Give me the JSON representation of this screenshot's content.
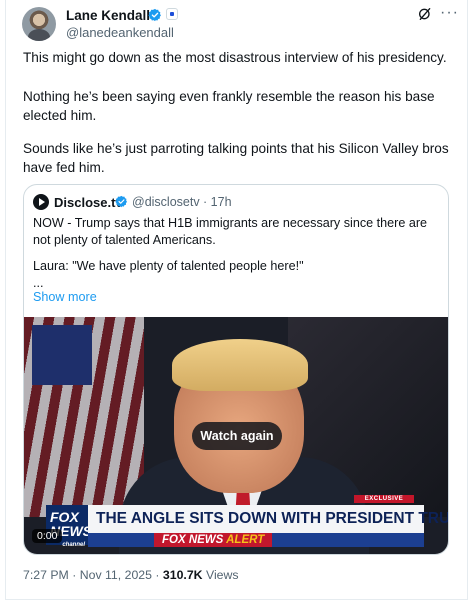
{
  "author": {
    "name": "Lane Kendall",
    "handle": "@lanedeankendall"
  },
  "tweet": {
    "paragraphs": [
      "This might go down as the most disastrous interview of his presidency.",
      "Nothing he’s been saying even frankly resemble the reason his base elected him.",
      "Sounds like he’s just parroting talking points that his Silicon Valley bros have fed him."
    ]
  },
  "quoted": {
    "name": "Disclose.tv",
    "handle_time": "@disclosetv · 17h",
    "text1": "NOW - Trump says that H1B immigrants are necessary since there are not plenty of talented Americans.",
    "text2": "Laura: \"We have plenty of talented people here!\"",
    "text3": "...",
    "show_more": "Show more",
    "video": {
      "watch_again": "Watch again",
      "exclusive": "EXCLUSIVE",
      "fox_logo_top": "FOX",
      "fox_logo_bottom": "NEWS",
      "fox_logo_small": "channel",
      "headline": "THE ANGLE SITS DOWN WITH PRESIDENT TRUMP",
      "alert_prefix": "FOX NEWS",
      "alert_word": "ALERT",
      "timestamp": "0:00"
    }
  },
  "footer": {
    "datetime": "7:27 PM · Nov 11, 2025 · ",
    "views_count": "310.7K",
    "views_label": " Views"
  },
  "icons": {
    "verified": "verified-badge-icon",
    "grok": "grok-icon",
    "more": "more-icon"
  },
  "colors": {
    "accent": "#1d9bf0",
    "secondary_text": "#536471"
  }
}
